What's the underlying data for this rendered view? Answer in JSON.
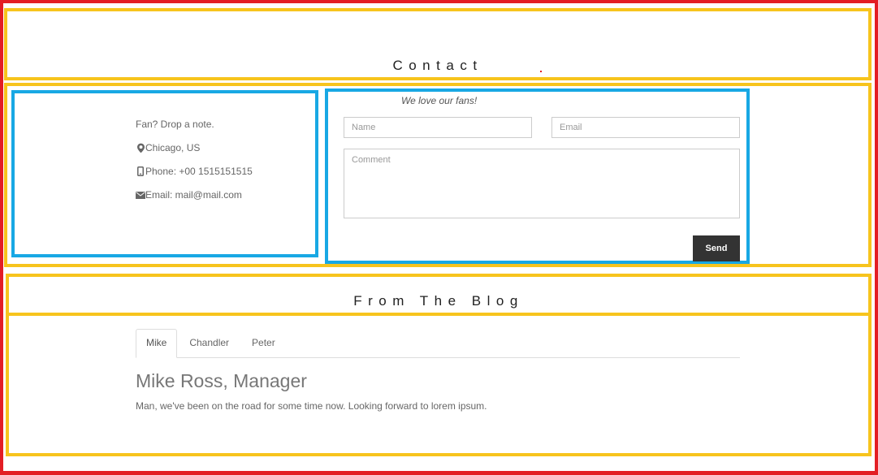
{
  "sections": {
    "contact": {
      "title": "Contact"
    },
    "blog": {
      "title": "From The Blog"
    }
  },
  "contact_info": {
    "intro": "Fan? Drop a note.",
    "location": {
      "icon": "map-marker-icon",
      "text": "Chicago, US"
    },
    "phone": {
      "icon": "mobile-phone-icon",
      "text": "Phone: +00 1515151515"
    },
    "email": {
      "icon": "envelope-icon",
      "text": "Email: mail@mail.com"
    }
  },
  "contact_form": {
    "tagline": "We love our fans!",
    "name": {
      "placeholder": "Name"
    },
    "email": {
      "placeholder": "Email"
    },
    "comment": {
      "placeholder": "Comment"
    },
    "send_label": "Send"
  },
  "blog": {
    "tabs": [
      {
        "label": "Mike",
        "active": true
      },
      {
        "label": "Chandler",
        "active": false
      },
      {
        "label": "Peter",
        "active": false
      }
    ],
    "active_post": {
      "heading": "Mike Ross, Manager",
      "body": "Man, we've been on the road for some time now. Looking forward to lorem ipsum."
    }
  },
  "colors": {
    "page_outline": "#e31e24",
    "section_outline": "#f7c41d",
    "column_outline": "#18a8e4",
    "button_bg": "#333333",
    "text": "#666666"
  }
}
